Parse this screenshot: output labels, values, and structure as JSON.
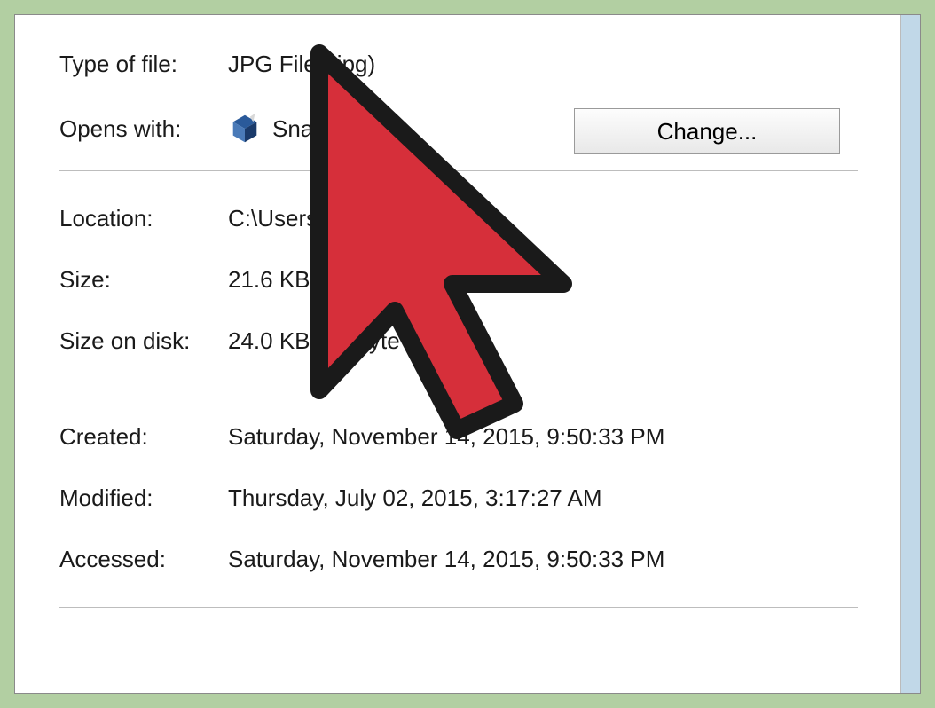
{
  "properties": {
    "type_label": "Type of file:",
    "type_value": "JPG File (.jpg)",
    "opens_label": "Opens with:",
    "opens_value": "Snagit",
    "change_button": "Change...",
    "location_label": "Location:",
    "location_value": "C:\\Users\\Us",
    "size_label": "Size:",
    "size_value": "21.6 KB (22",
    "size_on_disk_label": "Size on disk:",
    "size_on_disk_value": "24.0 KB (24        byte",
    "created_label": "Created:",
    "created_value": "Saturday, November 14, 2015, 9:50:33 PM",
    "modified_label": "Modified:",
    "modified_value": "Thursday, July 02, 2015, 3:17:27 AM",
    "accessed_label": "Accessed:",
    "accessed_value": "Saturday, November 14, 2015, 9:50:33 PM"
  }
}
